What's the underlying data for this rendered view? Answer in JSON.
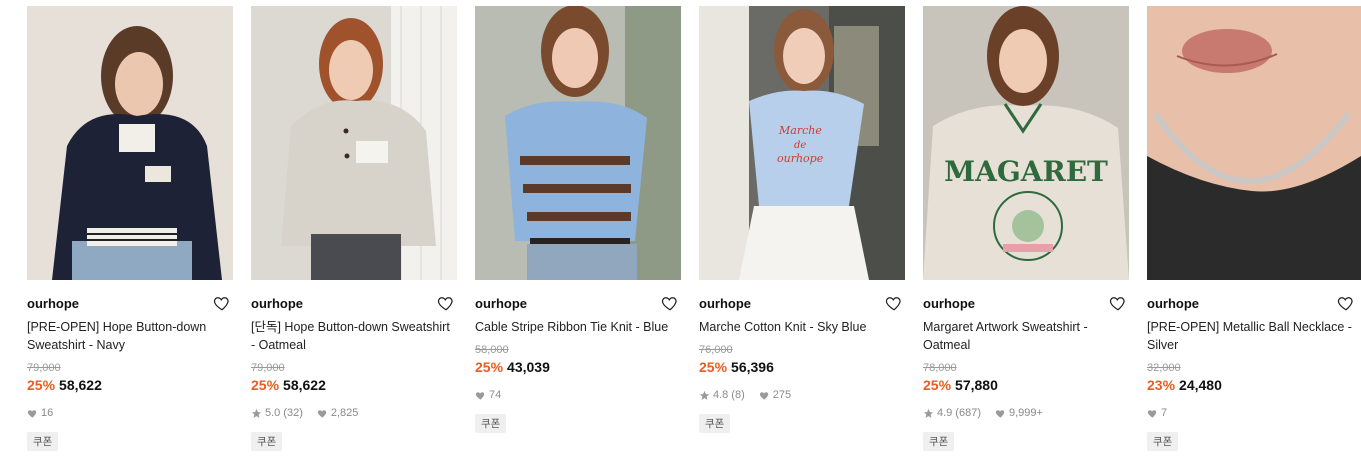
{
  "colors": {
    "discount": "#f05a1e",
    "meta_gray": "#8a8a8a",
    "coupon_bg": "#efefef"
  },
  "products": [
    {
      "brand": "ourhope",
      "title": "[PRE-OPEN] Hope Button-down Sweatshirt - Navy",
      "original_price": "79,000",
      "discount": "25%",
      "price": "58,622",
      "rating": "",
      "reviews": "",
      "likes": "16",
      "coupon": "쿠폰",
      "image": "navy-sweatshirt-photo"
    },
    {
      "brand": "ourhope",
      "title": "[단독] Hope Button-down Sweatshirt - Oatmeal",
      "original_price": "79,000",
      "discount": "25%",
      "price": "58,622",
      "rating": "5.0",
      "reviews": "(32)",
      "likes": "2,825",
      "coupon": "쿠폰",
      "image": "oatmeal-sweatshirt-photo"
    },
    {
      "brand": "ourhope",
      "title": "Cable Stripe Ribbon Tie Knit - Blue",
      "original_price": "58,000",
      "discount": "25%",
      "price": "43,039",
      "rating": "",
      "reviews": "",
      "likes": "74",
      "coupon": "쿠폰",
      "image": "blue-stripe-knit-photo"
    },
    {
      "brand": "ourhope",
      "title": "Marche Cotton Knit - Sky Blue",
      "original_price": "76,000",
      "discount": "25%",
      "price": "56,396",
      "rating": "4.8",
      "reviews": "(8)",
      "likes": "275",
      "coupon": "쿠폰",
      "image": "sky-blue-knit-photo"
    },
    {
      "brand": "ourhope",
      "title": "Margaret Artwork Sweatshirt - Oatmeal",
      "original_price": "78,000",
      "discount": "25%",
      "price": "57,880",
      "rating": "4.9",
      "reviews": "(687)",
      "likes": "9,999+",
      "coupon": "쿠폰",
      "image": "margaret-sweatshirt-photo"
    },
    {
      "brand": "ourhope",
      "title": "[PRE-OPEN] Metallic Ball Necklace - Silver",
      "original_price": "32,000",
      "discount": "23%",
      "price": "24,480",
      "rating": "",
      "reviews": "",
      "likes": "7",
      "coupon": "쿠폰",
      "image": "ball-necklace-photo"
    }
  ]
}
